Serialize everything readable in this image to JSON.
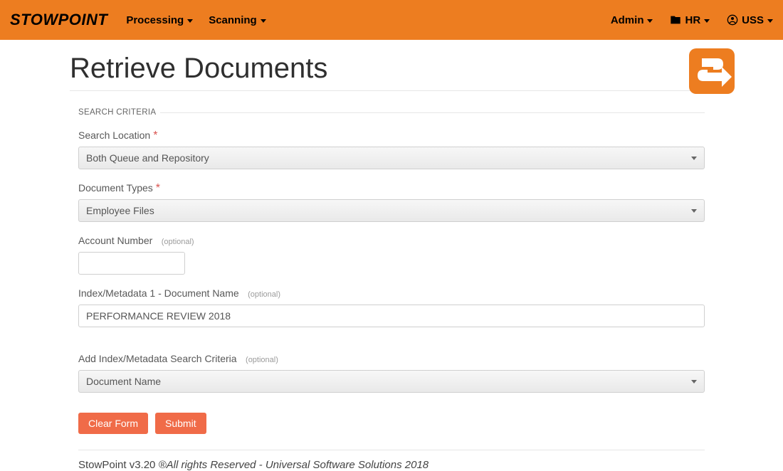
{
  "brand": {
    "stow": "STOW",
    "point": "POINT"
  },
  "nav": {
    "processing": "Processing",
    "scanning": "Scanning",
    "admin": "Admin",
    "hr": "HR",
    "uss": "USS"
  },
  "page": {
    "title": "Retrieve Documents",
    "legend": "SEARCH CRITERIA"
  },
  "fields": {
    "search_location": {
      "label": "Search Location",
      "value": "Both Queue and Repository"
    },
    "doc_types": {
      "label": "Document Types",
      "value": "Employee Files"
    },
    "account_number": {
      "label": "Account Number",
      "optional": "(optional)",
      "value": ""
    },
    "metadata1": {
      "label": "Index/Metadata 1 - Document Name",
      "optional": "(optional)",
      "value": "PERFORMANCE REVIEW 2018"
    },
    "add_metadata": {
      "label": "Add Index/Metadata Search Criteria",
      "optional": "(optional)",
      "value": "Document Name"
    }
  },
  "buttons": {
    "clear": "Clear Form",
    "submit": "Submit"
  },
  "footer": {
    "version": "StowPoint v3.20 ",
    "rights": "®All rights Reserved - Universal Software Solutions 2018"
  },
  "colors": {
    "brand": "#ed7d20",
    "button": "#f06b48"
  }
}
